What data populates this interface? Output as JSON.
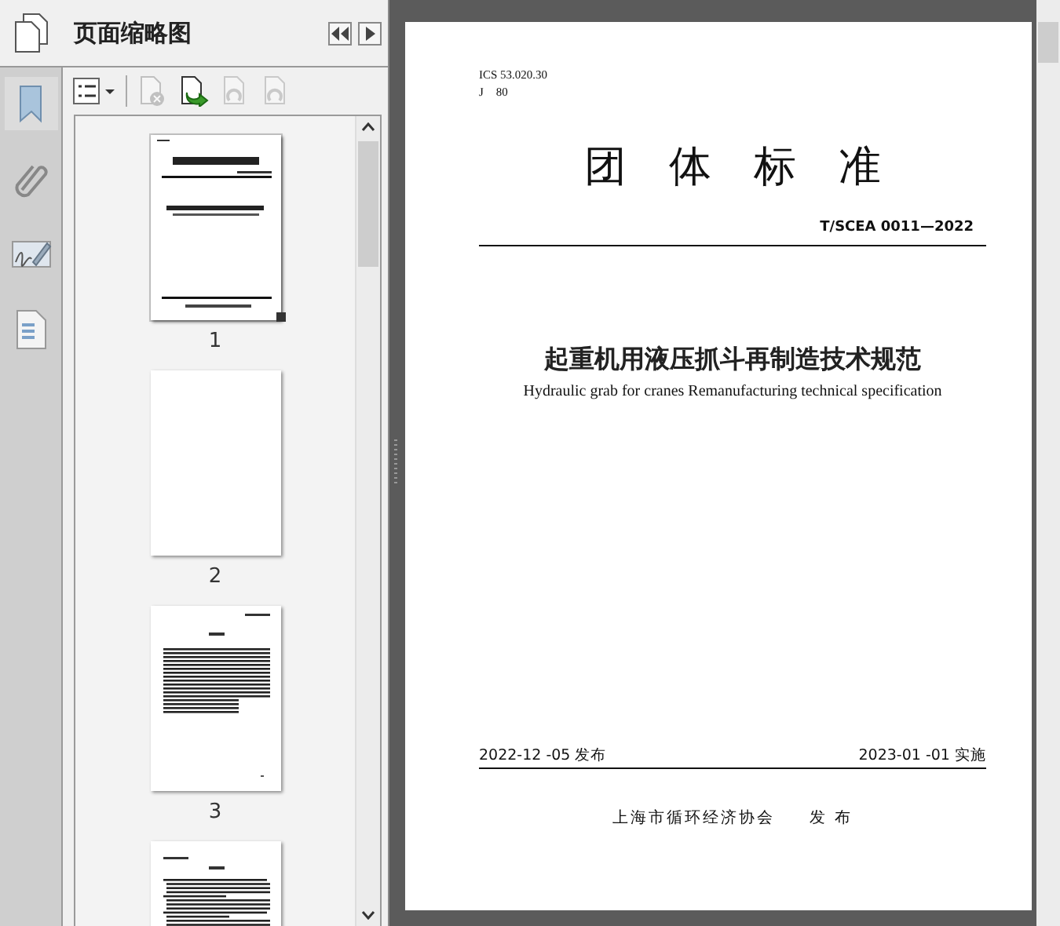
{
  "sidebar": {
    "title": "页面缩略图",
    "rail": [
      {
        "kind": "bookmark",
        "selected": true
      },
      {
        "kind": "attachment",
        "selected": false
      },
      {
        "kind": "signature",
        "selected": false
      },
      {
        "kind": "layers",
        "selected": false
      }
    ],
    "toolbar": [
      {
        "kind": "options",
        "disabled": false
      },
      {
        "kind": "delete",
        "disabled": true
      },
      {
        "kind": "insert",
        "disabled": false
      },
      {
        "kind": "rotate-left",
        "disabled": true
      },
      {
        "kind": "rotate-right",
        "disabled": true
      }
    ],
    "thumbnails": [
      {
        "kind": "cover",
        "label": "1",
        "selected": true
      },
      {
        "kind": "blank",
        "label": "2",
        "selected": false
      },
      {
        "kind": "contents",
        "label": "3",
        "selected": false
      },
      {
        "kind": "text",
        "selected": false
      }
    ]
  },
  "page": {
    "codes": [
      "ICS 53.020.30",
      "J　80"
    ],
    "heading": "团　体　标　准",
    "number": "T/SCEA 0011—2022",
    "title": "起重机用液压抓斗再制造技术规范",
    "subtitle": "Hydraulic grab for cranes Remanufacturing technical specification",
    "issued": "2022-12 -05 发布",
    "effective": "2023-01 -01 实施",
    "publisher": "上海市循环经济协会",
    "publish_word": "发 布"
  }
}
